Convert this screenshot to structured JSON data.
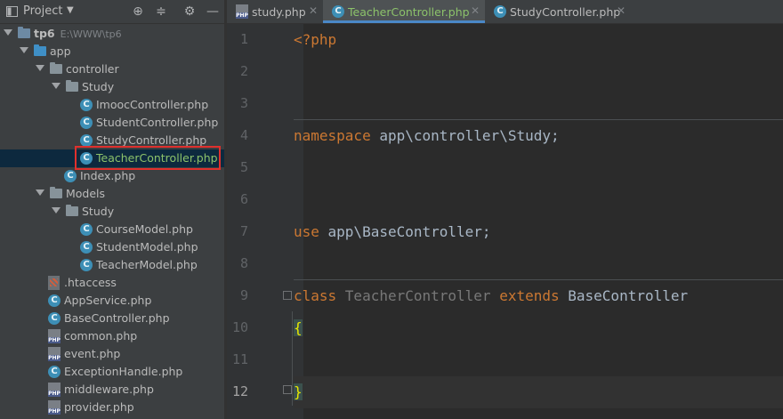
{
  "project_panel": {
    "title": "Project",
    "toolbar": [
      "locate-icon",
      "collapse-icon",
      "gear-icon",
      "hide-icon"
    ]
  },
  "tree": [
    {
      "label": "tp6",
      "path": "E:\\WWW\\tp6",
      "type": "root",
      "depth": 0,
      "expanded": true
    },
    {
      "label": "app",
      "type": "folder-blue",
      "depth": 1,
      "expanded": true
    },
    {
      "label": "controller",
      "type": "folder",
      "depth": 2,
      "expanded": true
    },
    {
      "label": "Study",
      "type": "folder",
      "depth": 3,
      "expanded": true
    },
    {
      "label": "ImoocController.php",
      "type": "class",
      "depth": 4
    },
    {
      "label": "StudentController.php",
      "type": "class",
      "depth": 4
    },
    {
      "label": "StudyController.php",
      "type": "class",
      "depth": 4
    },
    {
      "label": "TeacherController.php",
      "type": "class",
      "depth": 4,
      "selected": true
    },
    {
      "label": "Index.php",
      "type": "class",
      "depth": 3
    },
    {
      "label": "Models",
      "type": "folder",
      "depth": 2,
      "expanded": true
    },
    {
      "label": "Study",
      "type": "folder",
      "depth": 3,
      "expanded": true
    },
    {
      "label": "CourseModel.php",
      "type": "class",
      "depth": 4
    },
    {
      "label": "StudentModel.php",
      "type": "class",
      "depth": 4
    },
    {
      "label": "TeacherModel.php",
      "type": "class",
      "depth": 4
    },
    {
      "label": ".htaccess",
      "type": "htaccess",
      "depth": 2
    },
    {
      "label": "AppService.php",
      "type": "class",
      "depth": 2
    },
    {
      "label": "BaseController.php",
      "type": "class",
      "depth": 2
    },
    {
      "label": "common.php",
      "type": "php",
      "depth": 2
    },
    {
      "label": "event.php",
      "type": "php",
      "depth": 2
    },
    {
      "label": "ExceptionHandle.php",
      "type": "class",
      "depth": 2
    },
    {
      "label": "middleware.php",
      "type": "php",
      "depth": 2
    },
    {
      "label": "provider.php",
      "type": "php",
      "depth": 2
    }
  ],
  "tabs": [
    {
      "label": "study.php",
      "icon": "php-file-icon",
      "active": false
    },
    {
      "label": "TeacherController.php",
      "icon": "class-icon",
      "active": true
    },
    {
      "label": "StudyController.php",
      "icon": "class-icon",
      "active": false
    }
  ],
  "tab_close_glyph": "✕",
  "editor": {
    "current_line": 12,
    "lines": [
      {
        "n": 1,
        "tokens": [
          {
            "t": "<?php",
            "c": "kw"
          }
        ]
      },
      {
        "n": 2,
        "tokens": []
      },
      {
        "n": 3,
        "tokens": []
      },
      {
        "n": 4,
        "tokens": [
          {
            "t": "namespace ",
            "c": "kw"
          },
          {
            "t": "app\\controller\\Study;",
            "c": ""
          }
        ]
      },
      {
        "n": 5,
        "tokens": []
      },
      {
        "n": 6,
        "tokens": []
      },
      {
        "n": 7,
        "tokens": [
          {
            "t": "use ",
            "c": "kw"
          },
          {
            "t": "app\\BaseController;",
            "c": ""
          }
        ]
      },
      {
        "n": 8,
        "tokens": []
      },
      {
        "n": 9,
        "tokens": [
          {
            "t": "class ",
            "c": "kw"
          },
          {
            "t": "TeacherController",
            "c": "dim"
          },
          {
            "t": " extends ",
            "c": "kw"
          },
          {
            "t": "BaseController",
            "c": ""
          }
        ]
      },
      {
        "n": 10,
        "tokens": [
          {
            "t": "{",
            "c": "brace"
          }
        ]
      },
      {
        "n": 11,
        "tokens": []
      },
      {
        "n": 12,
        "tokens": [
          {
            "t": "}",
            "c": "brace"
          }
        ]
      }
    ]
  },
  "colors": {
    "selection_box": "#e0302d",
    "keyword": "#cc7832",
    "text": "#a9b7c6",
    "green_label": "#8cc26a"
  }
}
